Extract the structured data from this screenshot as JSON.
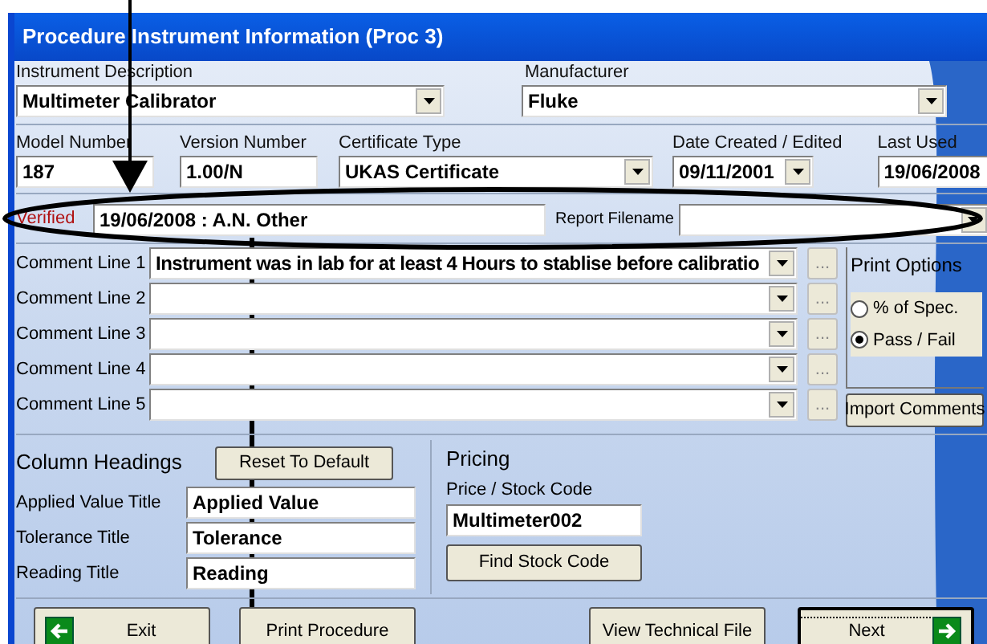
{
  "window": {
    "title": "Procedure Instrument Information (Proc 3)"
  },
  "instrument_description": {
    "label": "Instrument Description",
    "value": "Multimeter Calibrator"
  },
  "manufacturer": {
    "label": "Manufacturer",
    "value": "Fluke"
  },
  "model_number": {
    "label": "Model Number",
    "value": "187"
  },
  "version_number": {
    "label": "Version Number",
    "value": "1.00/N"
  },
  "certificate_type": {
    "label": "Certificate Type",
    "value": "UKAS Certificate"
  },
  "date_created": {
    "label": "Date Created / Edited",
    "value": "09/11/2001"
  },
  "last_used": {
    "label": "Last Used",
    "value": "19/06/2008"
  },
  "verified": {
    "label": "Verified",
    "value": "19/06/2008 : A.N. Other"
  },
  "report_filename": {
    "label": "Report Filename"
  },
  "comment_lines": [
    {
      "label": "Comment Line 1",
      "value": "Instrument was in lab for at least 4 Hours to stablise before calibratio",
      "more": "..."
    },
    {
      "label": "Comment Line 2",
      "more": "..."
    },
    {
      "label": "Comment Line 3",
      "more": "..."
    },
    {
      "label": "Comment Line 4",
      "more": "..."
    },
    {
      "label": "Comment Line 5",
      "more": "..."
    }
  ],
  "print_options": {
    "title": "Print Options",
    "options": [
      {
        "label": "% of Spec.",
        "selected": false
      },
      {
        "label": "Pass / Fail",
        "selected": true
      }
    ]
  },
  "import_comments_button": "Import Comments",
  "column_headings": {
    "title": "Column Headings",
    "reset_button": "Reset To Default",
    "fields": [
      {
        "label": "Applied Value Title",
        "value": "Applied Value"
      },
      {
        "label": "Tolerance Title",
        "value": "Tolerance"
      },
      {
        "label": "Reading Title",
        "value": "Reading"
      }
    ]
  },
  "pricing": {
    "title": "Pricing",
    "label": "Price / Stock Code",
    "value": "Multimeter002",
    "button": "Find Stock Code"
  },
  "buttons": [
    {
      "label": "Exit",
      "kind": "back",
      "default": false
    },
    {
      "label": "Print Procedure",
      "kind": "plain",
      "default": false
    },
    {
      "label": "View Technical File",
      "kind": "plain",
      "default": false
    },
    {
      "label": "Next",
      "kind": "forward",
      "default": true
    }
  ]
}
